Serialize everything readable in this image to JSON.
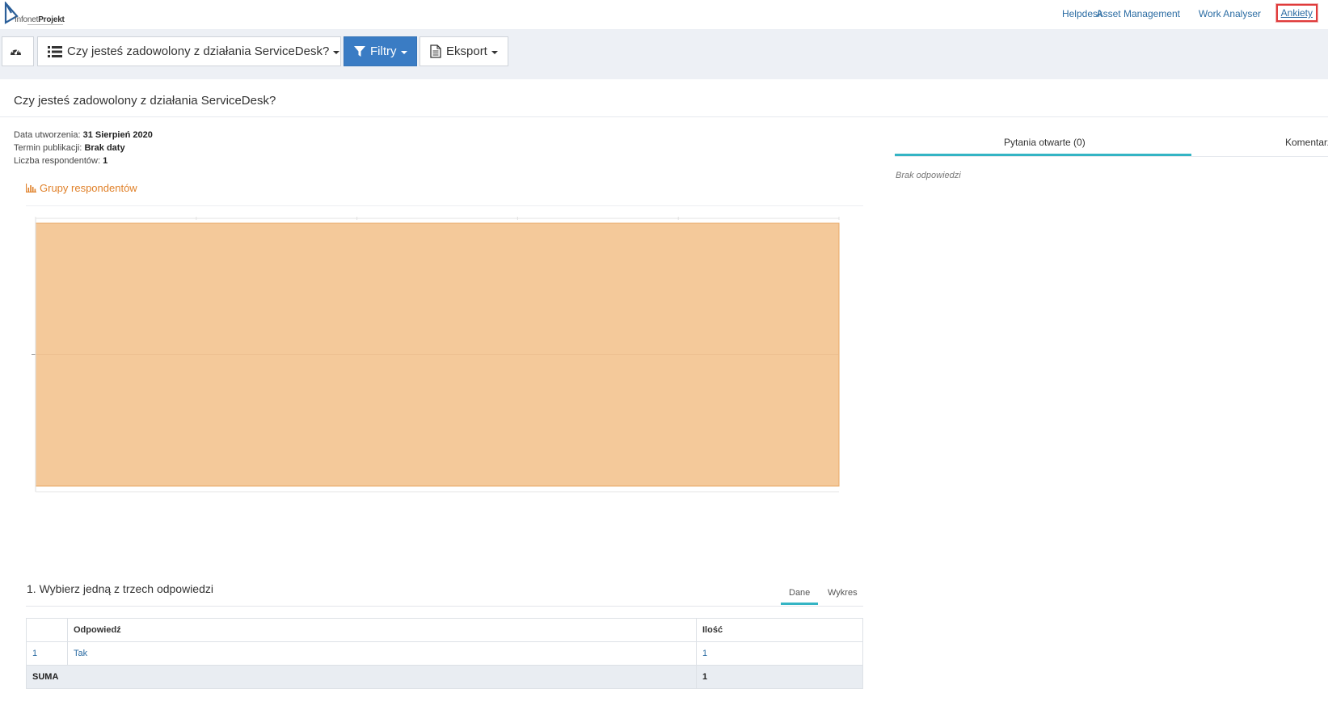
{
  "brand": {
    "name_light": "Infonet",
    "name_bold": "Projekt",
    "color": "#2b5f99"
  },
  "topnav": {
    "links": [
      {
        "label": "Helpdesk"
      },
      {
        "label": "Asset Management"
      },
      {
        "label": "Work Analyser"
      },
      {
        "label": "Ankiety",
        "active": true
      }
    ]
  },
  "toolbar": {
    "dashboard_icon": "dashboard-gauge-icon",
    "survey_select_label": "Czy jesteś zadowolony z działania ServiceDesk?",
    "filters_label": "Filtry",
    "export_label": "Eksport",
    "accent": "#3a7cc4"
  },
  "survey": {
    "title": "Czy jesteś zadowolony z działania ServiceDesk?",
    "created_label": "Data utworzenia:",
    "created_value": "31 Sierpień 2020",
    "publish_label": "Termin publikacji:",
    "publish_value": "Brak daty",
    "respondents_label": "Liczba respondentów:",
    "respondents_value": "1"
  },
  "respondent_groups": {
    "label": "Grupy respondentów",
    "icon": "bar-chart-icon",
    "color": "#e0812a"
  },
  "chart_data": {
    "type": "bar",
    "categories": [
      ""
    ],
    "values": [
      1
    ],
    "ylim": [
      0,
      1
    ],
    "grid": true,
    "bar_color": "#f4c99a",
    "bar_border": "#e8a865"
  },
  "question": {
    "title": "1. Wybierz jedną z trzech odpowiedzi",
    "tabs": [
      {
        "label": "Dane",
        "active": true
      },
      {
        "label": "Wykres",
        "active": false
      }
    ],
    "table": {
      "headers": [
        "",
        "Odpowiedź",
        "Ilość"
      ],
      "rows": [
        {
          "index": "1",
          "answer": "Tak",
          "count": "1"
        }
      ],
      "sum_label": "SUMA",
      "sum_value": "1"
    }
  },
  "right_panel": {
    "tabs": [
      {
        "label": "Pytania otwarte (0)",
        "active": true
      },
      {
        "label": "Komentarze"
      }
    ],
    "empty_text": "Brak odpowiedzi"
  }
}
